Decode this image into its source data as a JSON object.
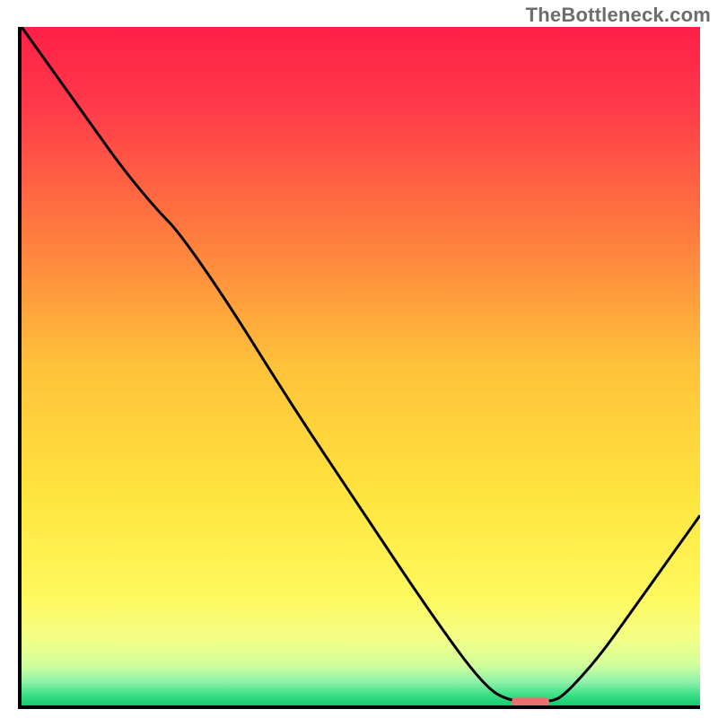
{
  "watermark": "TheBottleneck.com",
  "chart_data": {
    "type": "line",
    "title": "",
    "xlabel": "",
    "ylabel": "",
    "x": [
      0.0,
      0.05,
      0.1,
      0.15,
      0.2,
      0.23,
      0.3,
      0.4,
      0.5,
      0.6,
      0.68,
      0.72,
      0.78,
      0.8,
      0.85,
      0.9,
      0.95,
      1.0
    ],
    "values": [
      1.0,
      0.93,
      0.86,
      0.79,
      0.73,
      0.7,
      0.6,
      0.44,
      0.29,
      0.14,
      0.03,
      0.005,
      0.005,
      0.015,
      0.07,
      0.14,
      0.21,
      0.28
    ],
    "xlim": [
      0,
      1
    ],
    "ylim": [
      0,
      1
    ],
    "marker": {
      "x": 0.75,
      "y": 0.005,
      "color": "#e6736f"
    },
    "note": "x and y are normalized to the visible axes; no numeric tick labels are shown in the image"
  },
  "gradient": {
    "stops": [
      {
        "offset": 0.0,
        "color": "#ff1f47"
      },
      {
        "offset": 0.12,
        "color": "#ff3b4a"
      },
      {
        "offset": 0.3,
        "color": "#ff7a3f"
      },
      {
        "offset": 0.5,
        "color": "#ffc23a"
      },
      {
        "offset": 0.7,
        "color": "#ffe63f"
      },
      {
        "offset": 0.84,
        "color": "#fff95e"
      },
      {
        "offset": 0.9,
        "color": "#f4ff86"
      },
      {
        "offset": 0.94,
        "color": "#d2ff9c"
      },
      {
        "offset": 0.965,
        "color": "#8ff2a9"
      },
      {
        "offset": 0.985,
        "color": "#39df86"
      },
      {
        "offset": 1.0,
        "color": "#17c96e"
      }
    ]
  }
}
